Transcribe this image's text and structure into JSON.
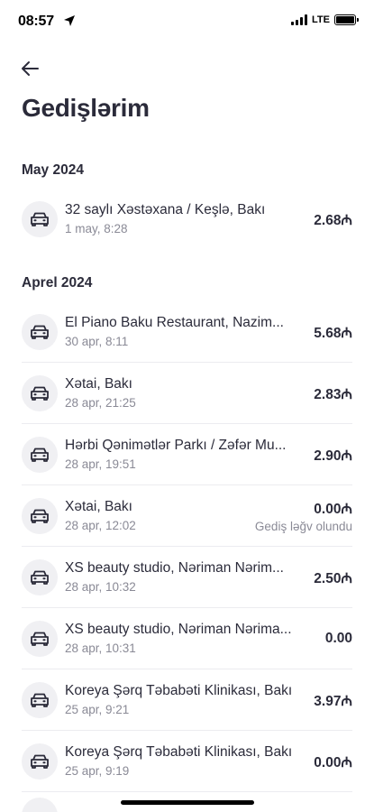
{
  "status": {
    "time": "08:57",
    "network": "LTE"
  },
  "page": {
    "title": "Gedişlərim"
  },
  "sections": [
    {
      "title": "May 2024",
      "trips": [
        {
          "title": "32 saylı Xəstəxana / Keşlə, Bakı",
          "date": "1 may, 8:28",
          "amount": "2.68₼",
          "note": ""
        }
      ]
    },
    {
      "title": "Aprel 2024",
      "trips": [
        {
          "title": "El Piano Baku Restaurant, Nazim...",
          "date": "30 apr, 8:11",
          "amount": "5.68₼",
          "note": ""
        },
        {
          "title": "Xətai, Bakı",
          "date": "28 apr, 21:25",
          "amount": "2.83₼",
          "note": ""
        },
        {
          "title": "Hərbi Qənimətlər Parkı / Zəfər Mu...",
          "date": "28 apr, 19:51",
          "amount": "2.90₼",
          "note": ""
        },
        {
          "title": "Xətai, Bakı",
          "date": "28 apr, 12:02",
          "amount": "0.00₼",
          "note": "Gediş ləğv olundu"
        },
        {
          "title": "XS beauty studio, Nəriman Nərim...",
          "date": "28 apr, 10:32",
          "amount": "2.50₼",
          "note": ""
        },
        {
          "title": "XS beauty studio, Nəriman Nərima...",
          "date": "28 apr, 10:31",
          "amount": "0.00",
          "note": ""
        },
        {
          "title": "Koreya Şərq Təbabəti Klinikası, Bakı",
          "date": "25 apr, 9:21",
          "amount": "3.97₼",
          "note": ""
        },
        {
          "title": "Koreya Şərq Təbabəti Klinikası, Bakı",
          "date": "25 apr, 9:19",
          "amount": "0.00₼",
          "note": ""
        }
      ]
    }
  ],
  "icons": {
    "back": "arrow-left-icon",
    "trip": "car-icon",
    "location": "location-arrow-icon"
  }
}
